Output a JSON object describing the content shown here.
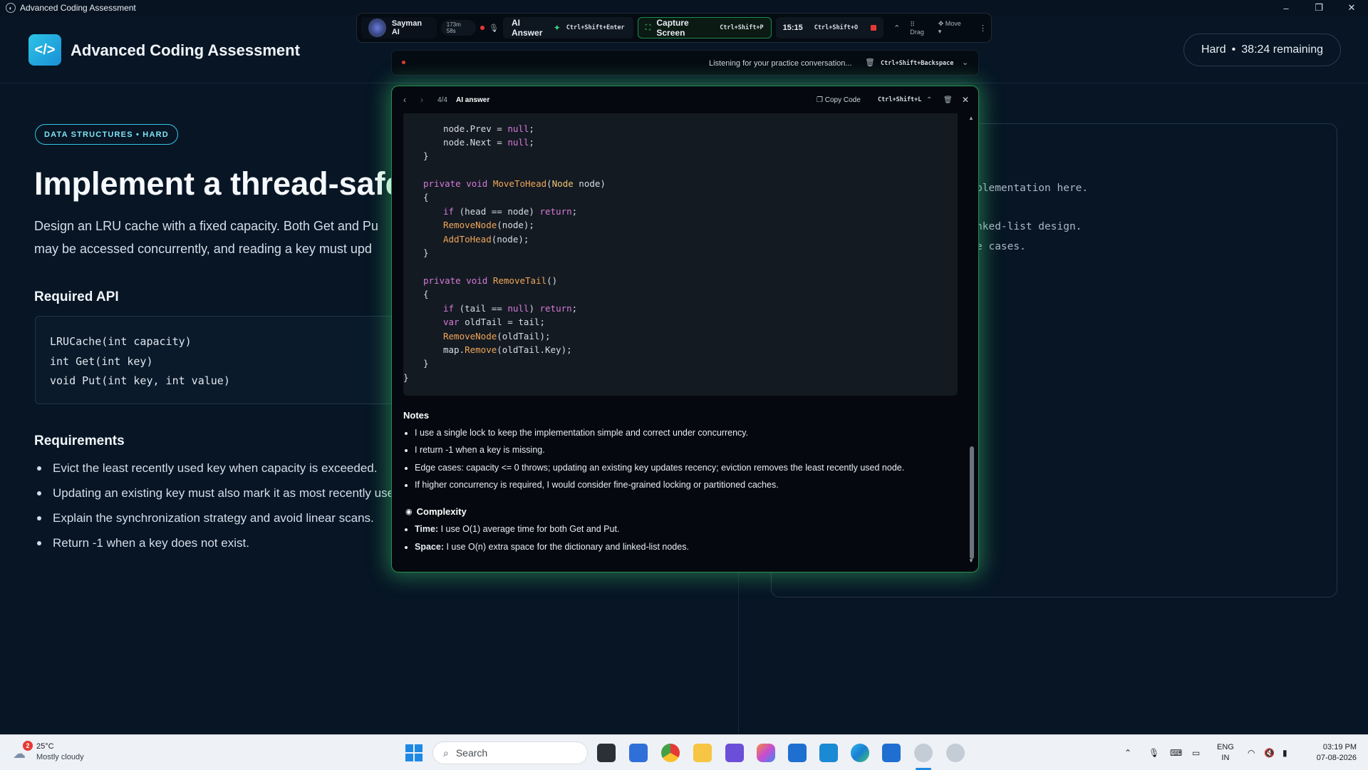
{
  "window": {
    "title": "Advanced Coding Assessment",
    "minimize": "–",
    "restore": "❐",
    "close": "✕"
  },
  "header": {
    "logo": "</>",
    "title": "Advanced Coding Assessment",
    "difficulty": "Hard",
    "separator": "•",
    "remaining": "38:24 remaining"
  },
  "problem": {
    "tag": "DATA STRUCTURES • HARD",
    "title": "Implement a thread-safe",
    "desc_line1": "Design an LRU cache with a fixed capacity. Both Get and Pu",
    "desc_line2": "may be accessed concurrently, and reading a key must upd",
    "api_heading": "Required API",
    "api": [
      "LRUCache(int capacity)",
      "int Get(int key)",
      "void Put(int key, int value)"
    ],
    "requirements_heading": "Requirements",
    "requirements": [
      "Evict the least recently used key when capacity is exceeded.",
      "Updating an existing key must also mark it as most recently use",
      "Explain the synchronization strategy and avoid linear scans.",
      "Return -1 when a key does not exist."
    ]
  },
  "editor": {
    "lines": [
      "plementation here.",
      "nked-list design.",
      "e cases."
    ]
  },
  "toolbar": {
    "app_name": "Sayman AI",
    "session_time": "173m 58s",
    "ai_answer_label": "AI Answer",
    "ai_answer_shortcut": "Ctrl+Shift+Enter",
    "capture_label": "Capture Screen",
    "capture_shortcut": "Ctrl+Shift+P",
    "clock": "15:15",
    "clock_shortcut": "Ctrl+Shift+O",
    "drag_label": "Drag",
    "move_label": "Move"
  },
  "listen": {
    "status": "Listening for your practice conversation...",
    "shortcut": "Ctrl+Shift+Backspace"
  },
  "ai_panel": {
    "counter": "4/4",
    "title": "AI answer",
    "copy_label": "Copy Code",
    "copy_shortcut": "Ctrl+Shift+L",
    "notes_heading": "Notes",
    "notes": [
      "I use a single lock to keep the implementation simple and correct under concurrency.",
      "I return -1 when a key is missing.",
      "Edge cases: capacity <= 0 throws; updating an existing key updates recency; eviction removes the least recently used node.",
      "If higher concurrency is required, I would consider fine-grained locking or partitioned caches."
    ],
    "complexity_heading": "Complexity",
    "time_label": "Time:",
    "time_text": " I use O(1) average time for both Get and Put.",
    "space_label": "Space:",
    "space_text": " I use O(n) extra space for the dictionary and linked-list nodes."
  },
  "taskbar": {
    "weather_temp": "25°C",
    "weather_desc": "Mostly cloudy",
    "weather_badge": "2",
    "search_placeholder": "Search",
    "lang1": "ENG",
    "lang2": "IN",
    "time": "03:19 PM",
    "date": "07-08-2026"
  },
  "colors": {
    "accent": "#35c6e4",
    "panel_glow": "#2c8a4e",
    "record": "#e53935"
  }
}
